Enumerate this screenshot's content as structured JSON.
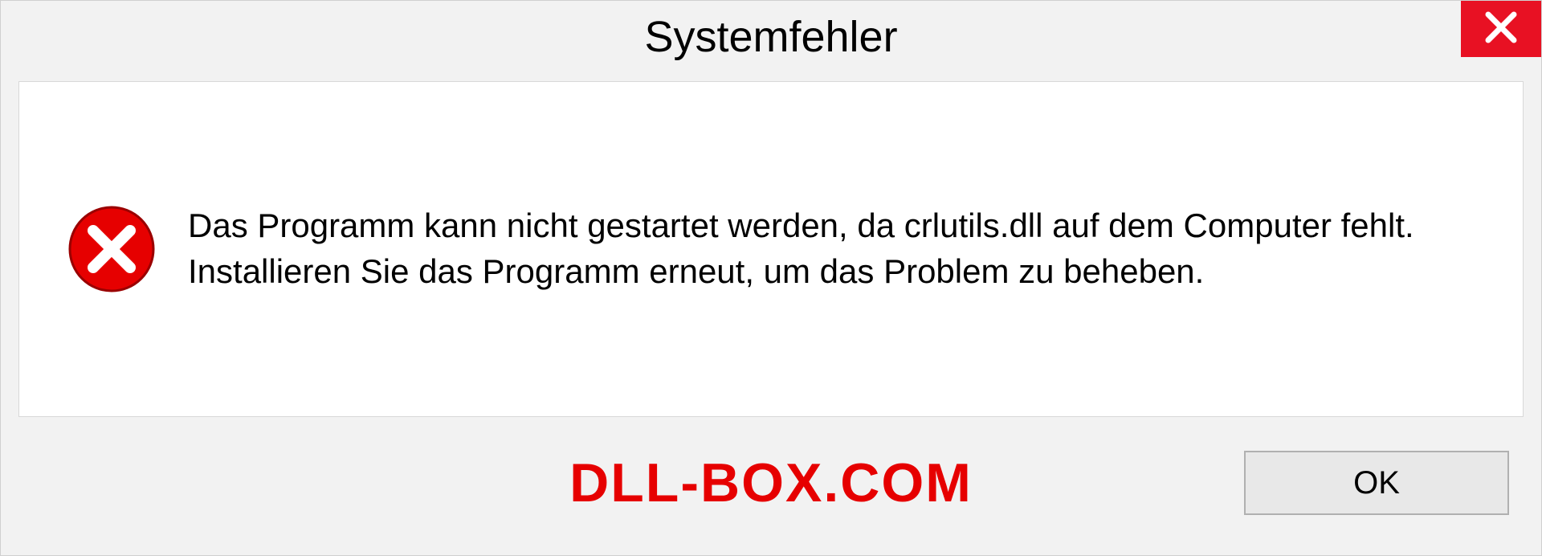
{
  "dialog": {
    "title": "Systemfehler",
    "message": "Das Programm kann nicht gestartet werden, da crlutils.dll auf dem Computer fehlt. Installieren Sie das Programm erneut, um das Problem zu beheben.",
    "ok_label": "OK"
  },
  "watermark": "DLL-BOX.COM"
}
